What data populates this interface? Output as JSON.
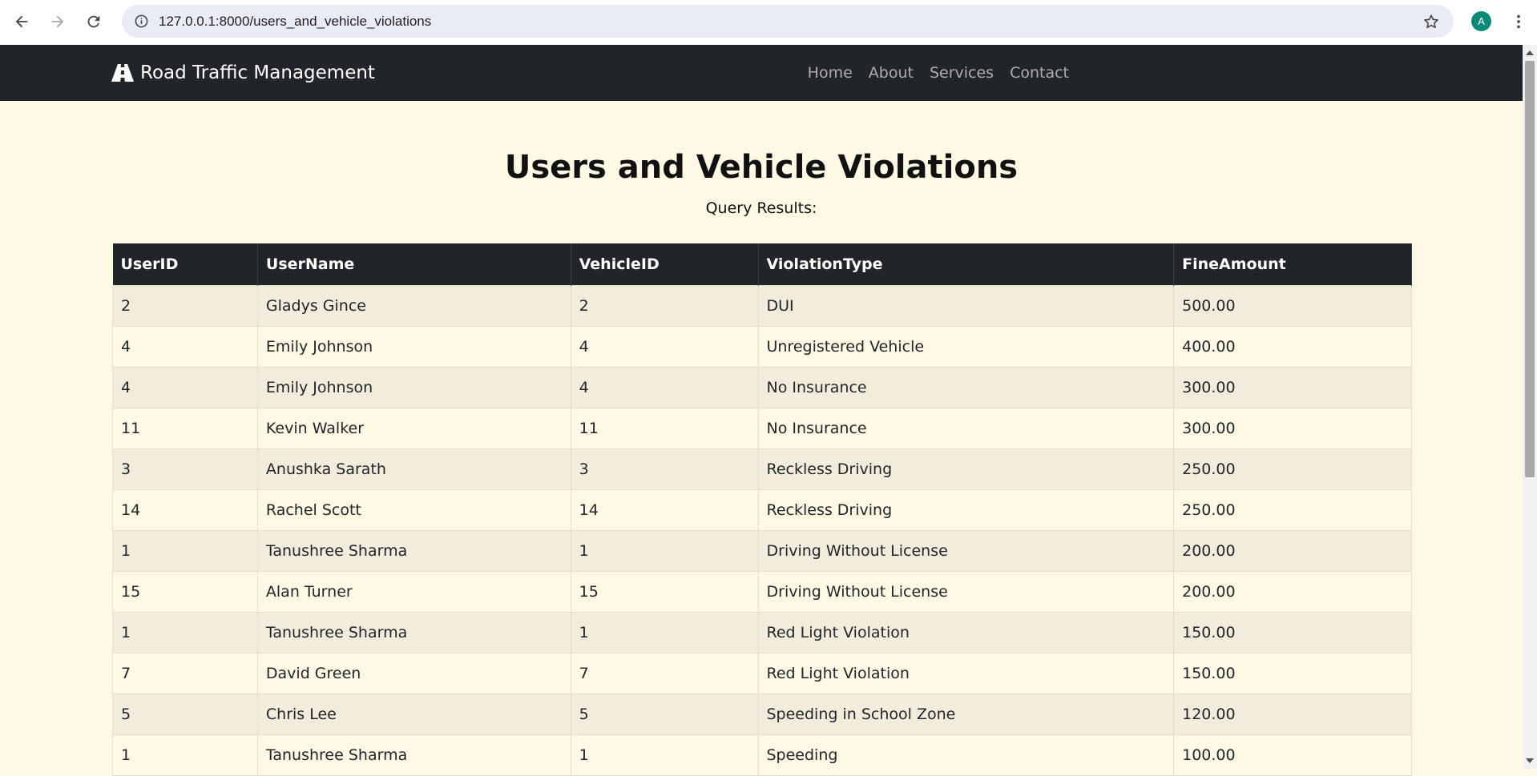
{
  "browser": {
    "url": "127.0.0.1:8000/users_and_vehicle_violations",
    "avatar_letter": "A"
  },
  "navbar": {
    "brand": "Road Traffic Management",
    "brand_icon": "road-icon",
    "links": [
      "Home",
      "About",
      "Services",
      "Contact"
    ]
  },
  "page": {
    "title": "Users and Vehicle Violations",
    "subtitle": "Query Results:"
  },
  "table": {
    "columns": [
      "UserID",
      "UserName",
      "VehicleID",
      "ViolationType",
      "FineAmount"
    ],
    "rows": [
      [
        "2",
        "Gladys Gince",
        "2",
        "DUI",
        "500.00"
      ],
      [
        "4",
        "Emily Johnson",
        "4",
        "Unregistered Vehicle",
        "400.00"
      ],
      [
        "4",
        "Emily Johnson",
        "4",
        "No Insurance",
        "300.00"
      ],
      [
        "11",
        "Kevin Walker",
        "11",
        "No Insurance",
        "300.00"
      ],
      [
        "3",
        "Anushka Sarath",
        "3",
        "Reckless Driving",
        "250.00"
      ],
      [
        "14",
        "Rachel Scott",
        "14",
        "Reckless Driving",
        "250.00"
      ],
      [
        "1",
        "Tanushree Sharma",
        "1",
        "Driving Without License",
        "200.00"
      ],
      [
        "15",
        "Alan Turner",
        "15",
        "Driving Without License",
        "200.00"
      ],
      [
        "1",
        "Tanushree Sharma",
        "1",
        "Red Light Violation",
        "150.00"
      ],
      [
        "7",
        "David Green",
        "7",
        "Red Light Violation",
        "150.00"
      ],
      [
        "5",
        "Chris Lee",
        "5",
        "Speeding in School Zone",
        "120.00"
      ],
      [
        "1",
        "Tanushree Sharma",
        "1",
        "Speeding",
        "100.00"
      ]
    ]
  },
  "colors": {
    "page_background": "#fdf9e5",
    "navbar_background": "#212529",
    "stripe": "#f1ecdc",
    "avatar": "#0b8a77"
  }
}
